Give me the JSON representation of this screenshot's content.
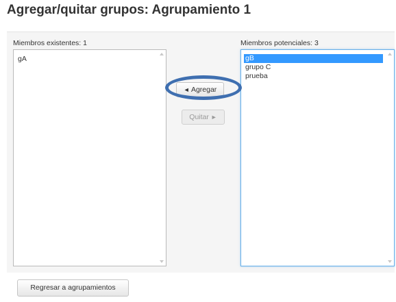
{
  "page": {
    "title": "Agregar/quitar grupos: Agrupamiento 1"
  },
  "existing": {
    "label": "Miembros existentes: 1",
    "options": [
      "gA"
    ]
  },
  "potential": {
    "label": "Miembros potenciales: 3",
    "options": [
      "gB",
      "grupo C",
      "prueba"
    ],
    "selected_index": 0
  },
  "buttons": {
    "add_arrow": "◄",
    "add_label": "Agregar",
    "remove_label": "Quitar",
    "remove_arrow": "►",
    "back_label": "Regresar a agrupamientos"
  },
  "colors": {
    "selection": "#3399ff",
    "annotation_ring": "#3f6fb0"
  }
}
